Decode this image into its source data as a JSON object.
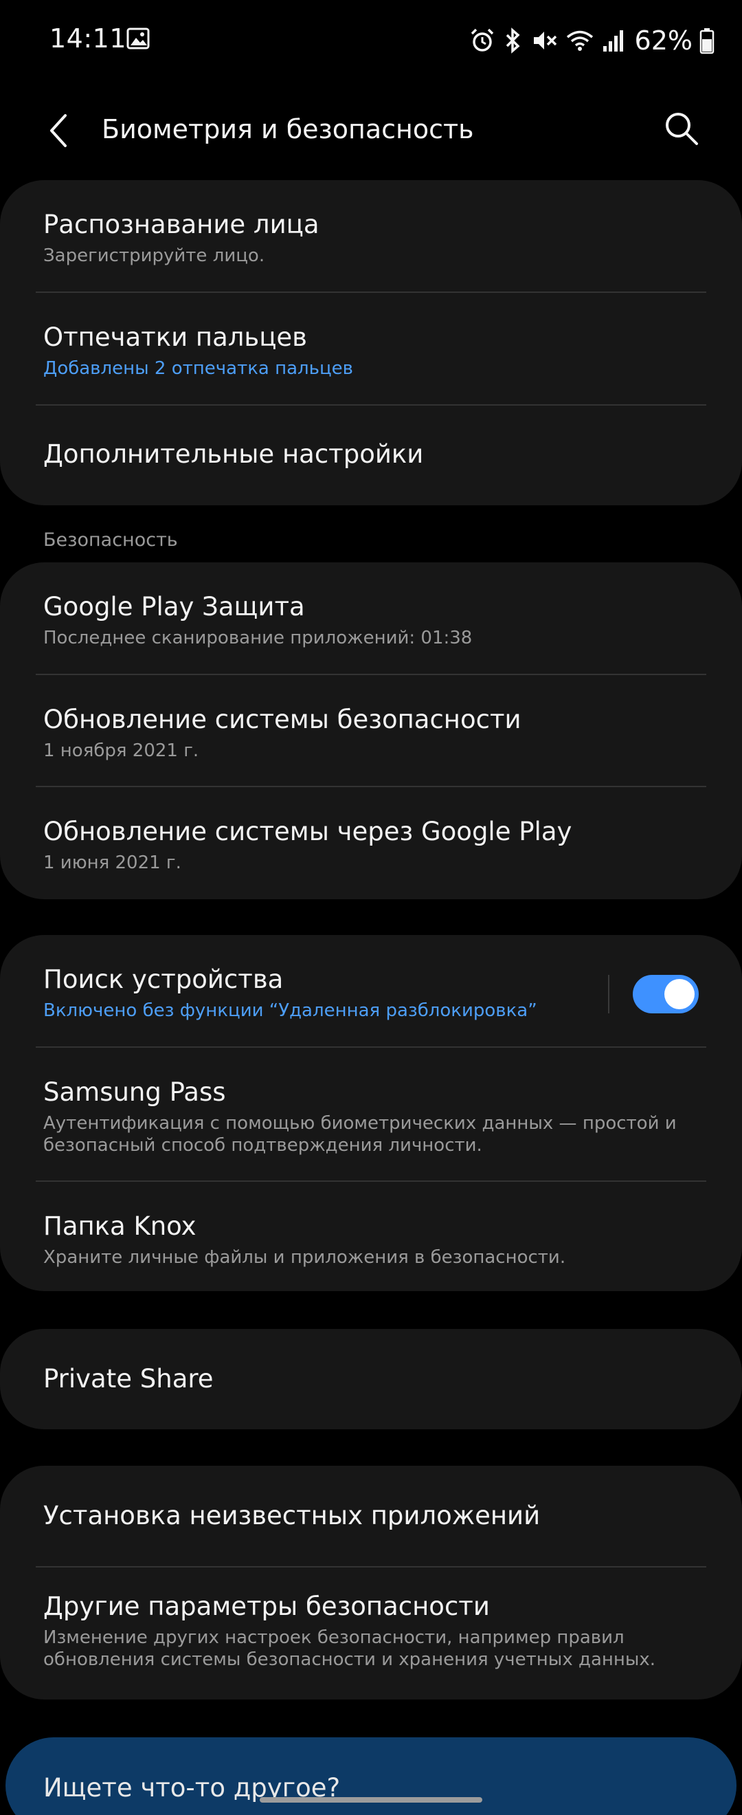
{
  "status_bar": {
    "time": "14:11",
    "battery": "62%",
    "icons": [
      "gallery-icon",
      "alarm-icon",
      "bluetooth-icon",
      "mute-icon",
      "wifi-icon",
      "signal-icon",
      "battery-icon"
    ]
  },
  "header": {
    "title": "Биометрия и безопасность",
    "back_icon": "back-arrow-icon",
    "search_icon": "search-icon"
  },
  "biometrics": [
    {
      "title": "Распознавание лица",
      "subtitle": "Зарегистрируйте лицо."
    },
    {
      "title": "Отпечатки пальцев",
      "subtitle": "Добавлены 2 отпечатка пальцев"
    },
    {
      "title": "Дополнительные настройки"
    }
  ],
  "security_section": {
    "label": "Безопасность",
    "items": [
      {
        "title": "Google Play Защита",
        "subtitle": "Последнее сканирование приложений: 01:38"
      },
      {
        "title": "Обновление системы безопасности",
        "subtitle": "1 ноября 2021 г."
      },
      {
        "title": "Обновление системы через Google Play",
        "subtitle": "1 июня 2021 г."
      }
    ]
  },
  "device_group": [
    {
      "title": "Поиск устройства",
      "subtitle": "Включено без функции “Удаленная разблокировка”",
      "toggle_on": true
    },
    {
      "title": "Samsung Pass",
      "subtitle": "Аутентификация с помощью биометрических данных — простой и безопасный способ подтверждения личности."
    },
    {
      "title": "Папка Knox",
      "subtitle": "Храните личные файлы и приложения в безопасности."
    }
  ],
  "private_share": {
    "title": "Private Share"
  },
  "other_group": [
    {
      "title": "Установка неизвестных приложений"
    },
    {
      "title": "Другие параметры безопасности",
      "subtitle": "Изменение других настроек безопасности, например правил обновления системы безопасности и хранения учетных данных."
    }
  ],
  "suggestion": {
    "text": "Ищете что-то другое?"
  },
  "colors": {
    "background": "#000000",
    "card": "#171717",
    "accent": "#4d9ef6",
    "toggle_on": "#3e91ff",
    "suggestion_card": "#0d3a66"
  }
}
